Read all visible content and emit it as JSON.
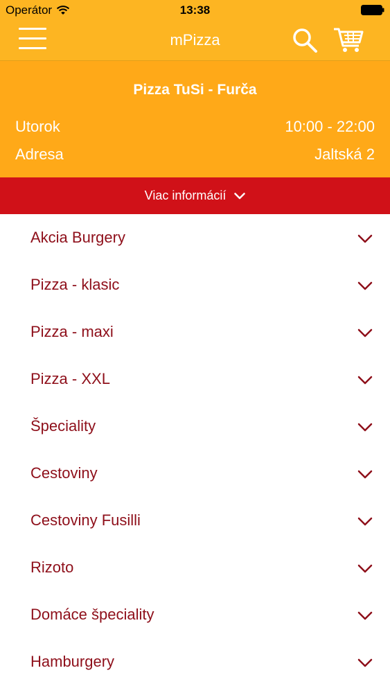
{
  "status_bar": {
    "carrier": "Operátor",
    "time": "13:38"
  },
  "nav": {
    "title": "mPizza",
    "icons": [
      "menu-icon",
      "search-icon",
      "cart-icon"
    ]
  },
  "restaurant": {
    "name": "Pizza TuSi - Furča",
    "day_label": "Utorok",
    "hours": "10:00 - 22:00",
    "address_label": "Adresa",
    "address": "Jaltská 2"
  },
  "more_info": {
    "label": "Viac informácií"
  },
  "categories": [
    {
      "label": "Akcia Burgery"
    },
    {
      "label": "Pizza - klasic"
    },
    {
      "label": "Pizza - maxi"
    },
    {
      "label": "Pizza - XXL"
    },
    {
      "label": "Špeciality"
    },
    {
      "label": "Cestoviny"
    },
    {
      "label": "Cestoviny Fusilli"
    },
    {
      "label": "Rizoto"
    },
    {
      "label": "Domáce špeciality"
    },
    {
      "label": "Hamburgery"
    }
  ],
  "colors": {
    "header_yellow": "#fdb522",
    "info_orange": "#ffa918",
    "accent_red": "#d01118",
    "category_text": "#8e0f1a"
  }
}
